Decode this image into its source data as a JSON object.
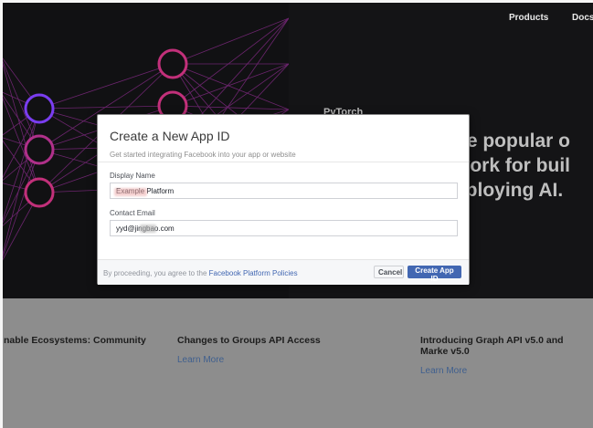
{
  "nav": {
    "products": "Products",
    "docs": "Docs"
  },
  "hero": {
    "brand": "PyTorch",
    "line1": "he popular o",
    "line2": "work for buil",
    "line3": "eploying AI."
  },
  "news": [
    {
      "title": "nable Ecosystems: Community",
      "link": ""
    },
    {
      "title": "Changes to Groups API Access",
      "link": "Learn More"
    },
    {
      "title": "Introducing Graph API v5.0 and Marke v5.0",
      "link": "Learn More"
    }
  ],
  "modal": {
    "title": "Create a New App ID",
    "subtitle": "Get started integrating Facebook into your app or website",
    "display_name_label": "Display Name",
    "display_name_value": "Example Platform",
    "contact_email_label": "Contact Email",
    "contact_email_value": "yyd@jingbao.com",
    "footer_prefix": "By proceeding, you agree to the ",
    "footer_link": "Facebook Platform Policies",
    "cancel_label": "Cancel",
    "create_label": "Create App ID"
  },
  "colors": {
    "accent": "#4267b2",
    "node_pink": "#c2307a",
    "node_purple": "#7a3df0"
  }
}
